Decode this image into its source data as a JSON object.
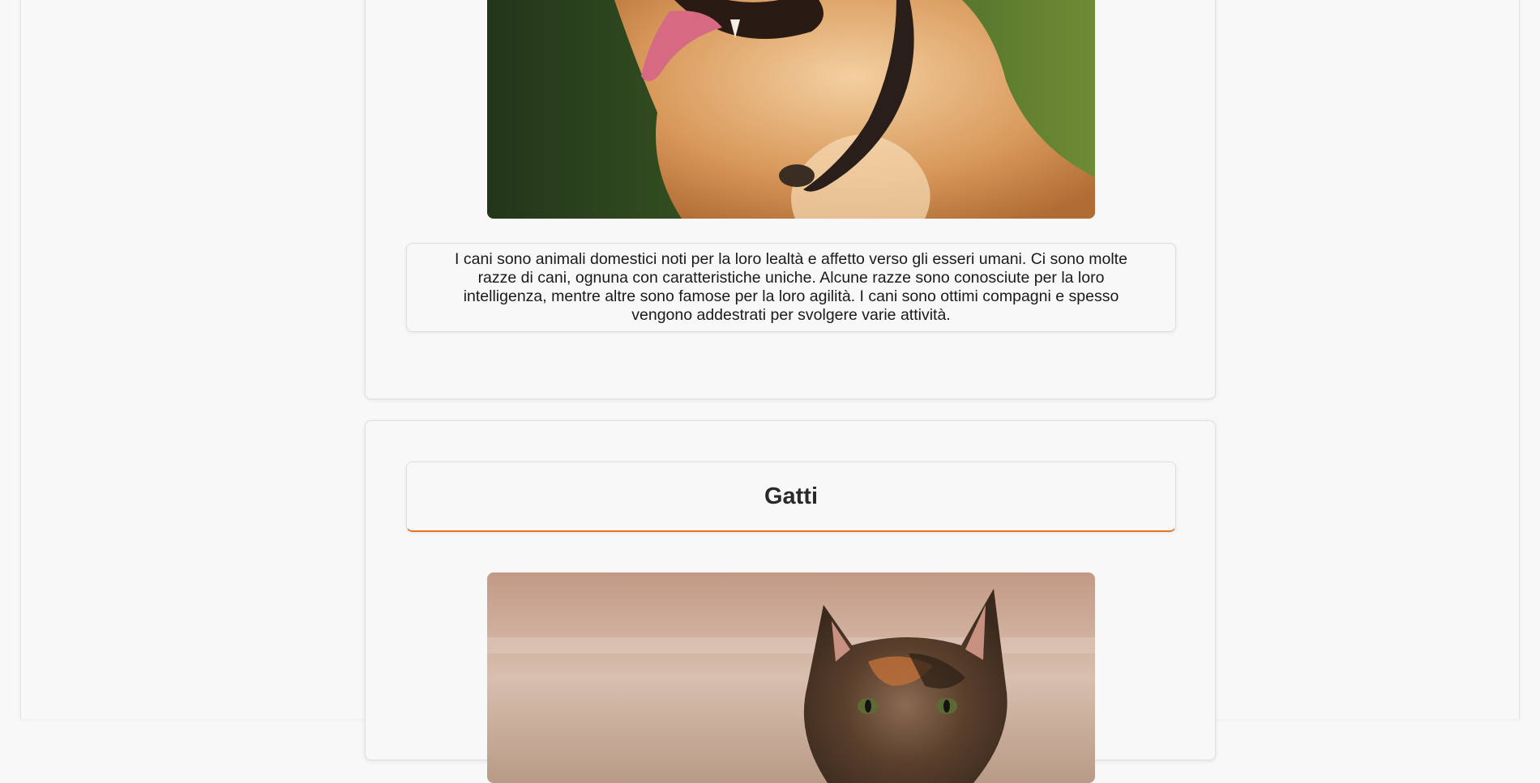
{
  "sections": {
    "dogs": {
      "image_subject": "golden dog with collar and tongue out",
      "description": "I cani sono animali domestici noti per la loro lealtà e affetto verso gli esseri umani. Ci sono molte razze di cani, ognuna con caratteristiche uniche. Alcune razze sono conosciute per la loro intelligenza, mentre altre sono famose per la loro agilità. I cani sono ottimi compagni e spesso vengono addestrati per svolgere varie attività."
    },
    "cats": {
      "title": "Gatti",
      "image_subject": "tortoiseshell cat"
    }
  },
  "colors": {
    "page_background": "#f8f8f8",
    "card_border": "#e1e1e1",
    "heading_accent": "#e8731f",
    "text": "#1a1a1a"
  }
}
